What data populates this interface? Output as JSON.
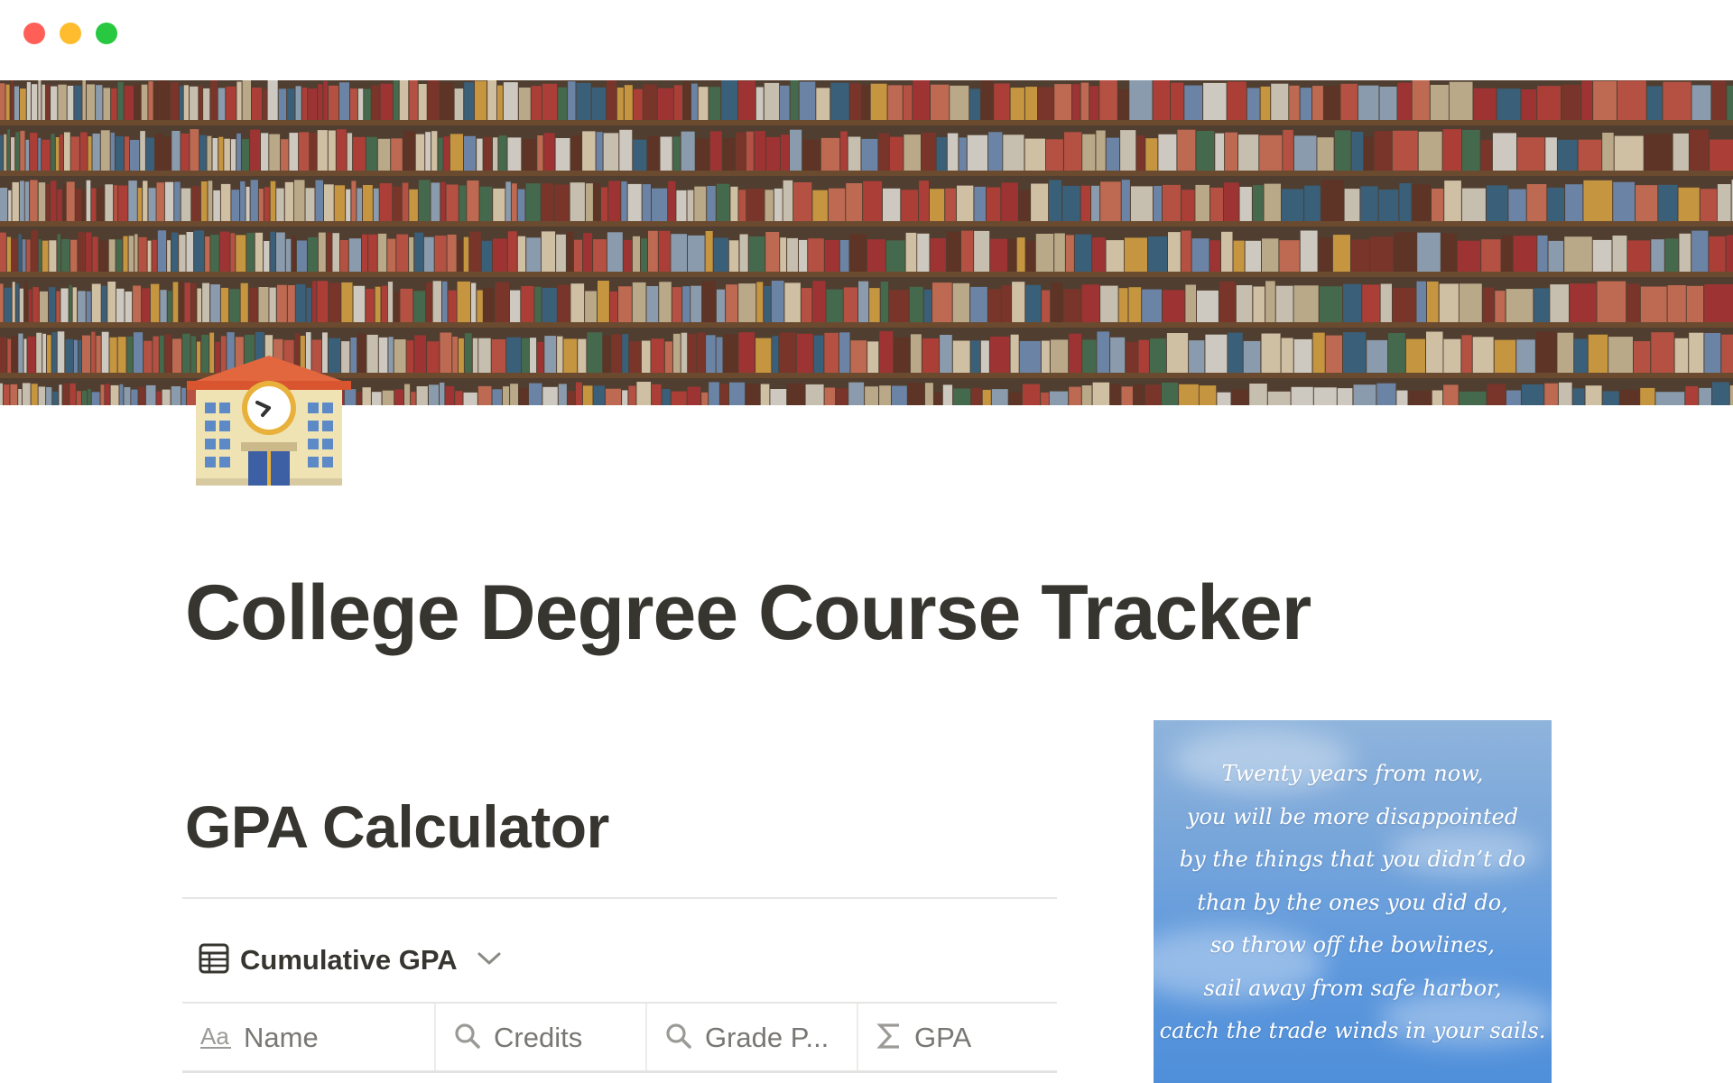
{
  "window": {
    "controls": [
      "close",
      "minimize",
      "zoom"
    ],
    "colors": {
      "close": "#ff5f57",
      "minimize": "#febc2e",
      "zoom": "#28c840"
    }
  },
  "cover": {
    "icon": "library-bookshelf-cover-image"
  },
  "page": {
    "icon": "school-building-emoji",
    "title": "College Degree Course Tracker"
  },
  "gpa_section": {
    "heading": "GPA Calculator",
    "view": {
      "icon": "table-icon",
      "label": "Cumulative GPA",
      "chevron": "chevron-down-icon"
    },
    "columns": [
      {
        "icon": "text-property-icon",
        "label": "Name"
      },
      {
        "icon": "search-icon",
        "label": "Credits"
      },
      {
        "icon": "search-icon",
        "label": "Grade P..."
      },
      {
        "icon": "sigma-icon",
        "label": "GPA"
      }
    ]
  },
  "quote": {
    "lines": [
      "Twenty years from now,",
      "you will be more disappointed",
      "by the things that you didn’t do",
      "than by the ones you did do,",
      "so throw off the bowlines,",
      "sail away from safe harbor,",
      "catch the trade winds in your sails."
    ]
  },
  "colors": {
    "text": "#37352f",
    "muted": "#787774",
    "divider": "#e6e6e4"
  }
}
